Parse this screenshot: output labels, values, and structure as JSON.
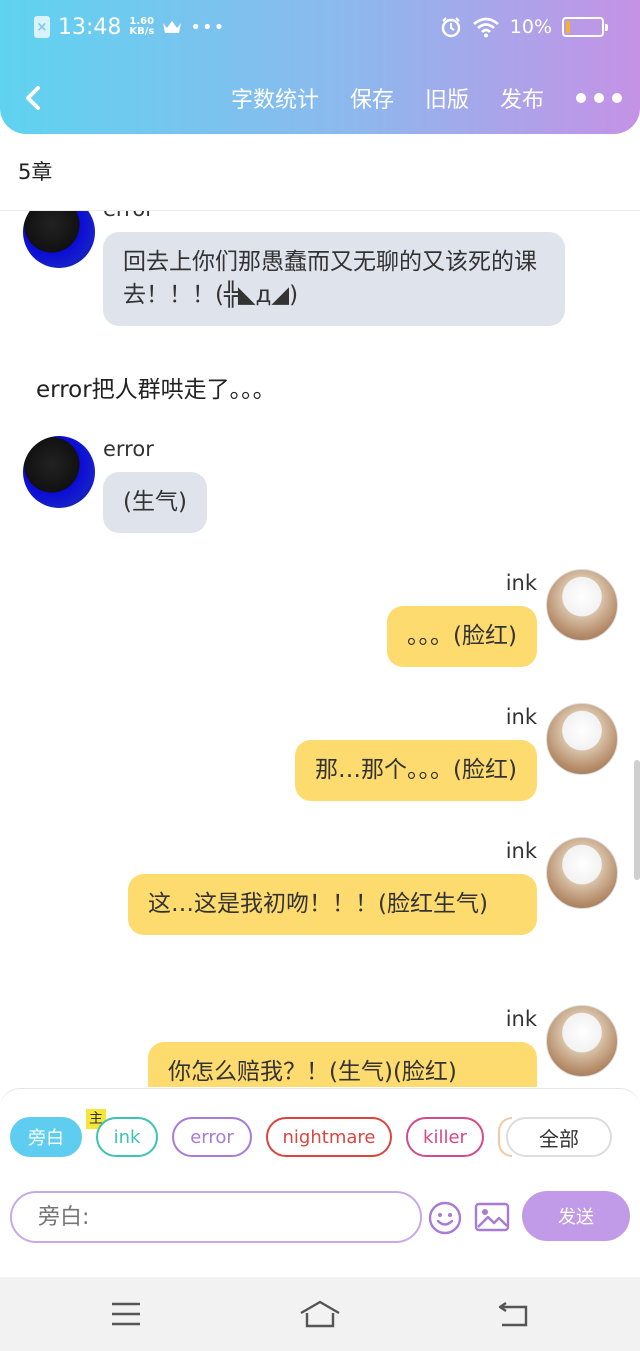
{
  "status_bar": {
    "time": "13:48",
    "speed_value": "1.60",
    "speed_unit": "KB/s",
    "battery": "10%"
  },
  "header": {
    "actions": [
      "字数统计",
      "保存",
      "旧版",
      "发布"
    ]
  },
  "chapter_title": "5章",
  "messages": [
    {
      "type": "left",
      "sender": "error",
      "text": "回去上你们那愚蠢而又无聊的又该死的课去！！！(╬◣д◢)"
    },
    {
      "type": "narration",
      "text": "error把人群哄走了。。。"
    },
    {
      "type": "left",
      "sender": "error",
      "text": "(生气)"
    },
    {
      "type": "right",
      "sender": "ink",
      "text": "。。。(脸红)"
    },
    {
      "type": "right",
      "sender": "ink",
      "text": "那…那个。。。(脸红)"
    },
    {
      "type": "right",
      "sender": "ink",
      "text": "这…这是我初吻！！！(脸红生气)"
    },
    {
      "type": "right",
      "sender": "ink",
      "text": "你怎么赔我？！(生气)(脸红)"
    }
  ],
  "character_bar": {
    "active_chip": "旁白",
    "main_badge": "主",
    "chips": [
      {
        "label": "ink",
        "color": "#3cc3b4"
      },
      {
        "label": "error",
        "color": "#a77bd6"
      },
      {
        "label": "nightmare",
        "color": "#d9463f"
      },
      {
        "label": "killer",
        "color": "#d44a8a"
      }
    ],
    "all_label": "全部"
  },
  "composer": {
    "placeholder": "旁白:",
    "send_label": "发送"
  },
  "colors": {
    "bubble_left": "#dfe4ec",
    "bubble_right": "#fedb6e",
    "accent_purple": "#c29be8",
    "accent_cyan": "#5fcdf0"
  },
  "icons": {
    "back": "chevron-left-icon",
    "more": "more-dots-icon",
    "emoji": "smiley-icon",
    "image": "image-icon",
    "sys_menu": "menu-icon",
    "sys_home": "home-icon",
    "sys_back": "return-icon"
  }
}
